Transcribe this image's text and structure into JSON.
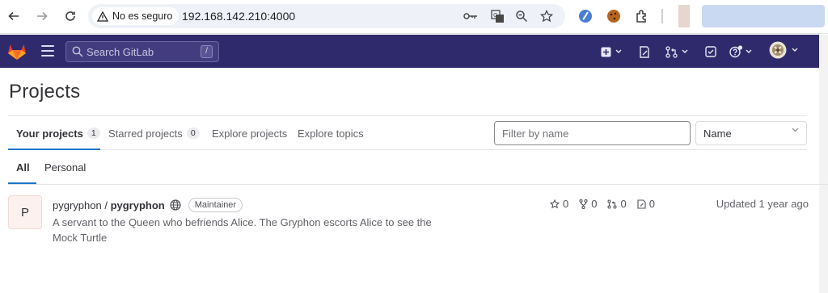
{
  "browser": {
    "security_label": "No es seguro",
    "url": "192.168.142.210:4000"
  },
  "topbar": {
    "search_placeholder": "Search GitLab",
    "search_shortcut": "/"
  },
  "page": {
    "title": "Projects"
  },
  "tabs": [
    {
      "label": "Your projects",
      "count": "1"
    },
    {
      "label": "Starred projects",
      "count": "0"
    },
    {
      "label": "Explore projects"
    },
    {
      "label": "Explore topics"
    }
  ],
  "filter": {
    "placeholder": "Filter by name"
  },
  "sort": {
    "selected": "Name"
  },
  "subtabs": [
    {
      "label": "All"
    },
    {
      "label": "Personal"
    }
  ],
  "projects": [
    {
      "avatar_letter": "P",
      "namespace": "pygryphon /",
      "name": "pygryphon",
      "role": "Maintainer",
      "description": "A servant to the Queen who befriends Alice. The Gryphon escorts Alice to see the Mock Turtle",
      "stars": "0",
      "forks": "0",
      "merge_requests": "0",
      "issues": "0",
      "updated": "Updated 1 year ago"
    }
  ],
  "colors": {
    "topbar_bg": "#2f2a6b",
    "accent": "#1f75cb",
    "gitlab_orange": "#fc6d26"
  }
}
